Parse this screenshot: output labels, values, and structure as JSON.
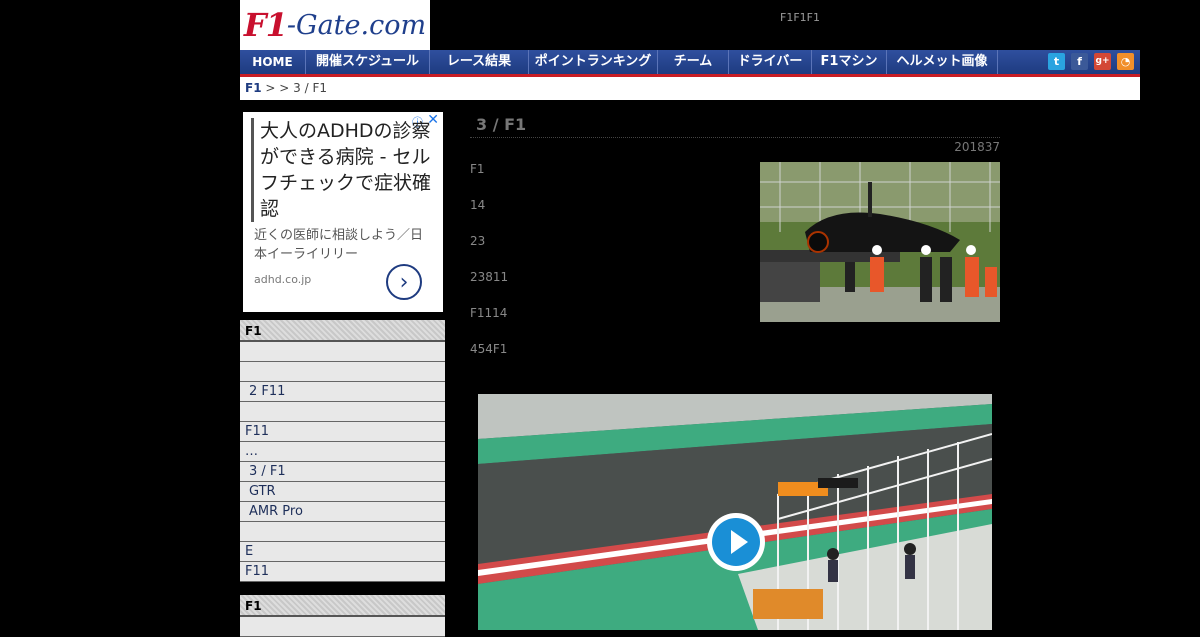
{
  "header": {
    "logo_part1": "F1",
    "logo_part2": "-Gate.com",
    "tagline": "F1F1F1"
  },
  "nav": {
    "items": [
      {
        "label": "HOME"
      },
      {
        "label": "開催スケジュール"
      },
      {
        "label": "レース結果"
      },
      {
        "label": "ポイントランキング"
      },
      {
        "label": "チーム"
      },
      {
        "label": "ドライバー"
      },
      {
        "label": "F1マシン"
      },
      {
        "label": "ヘルメット画像"
      }
    ],
    "social": [
      "twitter-icon",
      "facebook-icon",
      "google-plus-icon",
      "rss-icon"
    ]
  },
  "breadcrumb": {
    "root": "F1",
    "sep1": ">",
    "sep2": ">",
    "current": "3 / F1"
  },
  "ad": {
    "headline": "大人のADHDの診察ができる病院 - セルフチェックで症状確認",
    "description": "近くの医師に相談しよう／日本イーライリリー",
    "url": "adhd.co.jp",
    "arrow": "›",
    "info": "ⓘ",
    "close": "✕"
  },
  "sidebar": {
    "section1_title": "F1",
    "section1_rows": [
      "",
      "",
      "2 F11",
      "",
      "F11",
      "…",
      "3 / F1",
      "GTR",
      "AMR Pro",
      "",
      "E",
      "F11"
    ],
    "section2_title": "F1"
  },
  "article": {
    "title": "3 / F1",
    "date": "201837",
    "lines": [
      "F1",
      "14",
      "23",
      "23811",
      "F1114",
      "454F1"
    ]
  },
  "colors": {
    "nav_bg": "#1e3b80",
    "nav_accent": "#c81c24",
    "play_blue": "#1a8fd6"
  }
}
